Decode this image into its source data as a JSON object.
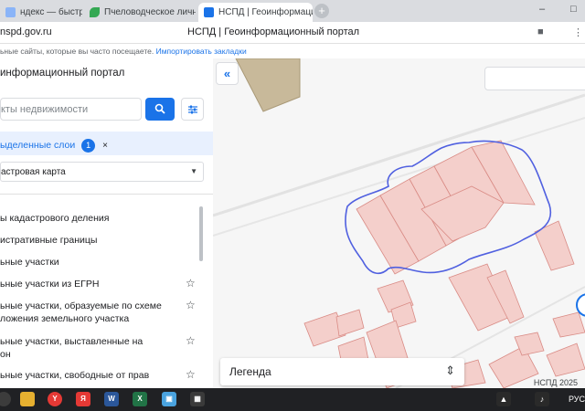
{
  "browser": {
    "tabs": [
      {
        "label": "ндекс — быстрый поиск",
        "icon": "yandex-tab-icon",
        "color": "#8ab4f8"
      },
      {
        "label": "Пчеловодческое личное",
        "icon": "plant-tab-icon",
        "color": "#34a853"
      },
      {
        "label": "НСПД | Геоинформацио",
        "icon": "nspd-tab-icon",
        "color": "#1a73e8"
      }
    ],
    "new_tab": "+",
    "minimize": "–",
    "maximize": "□",
    "url": "nspd.gov.ru",
    "page_title": "НСПД | Геоинформационный портал",
    "infobar_text": "ьные сайты, которые вы часто посещаете.",
    "infobar_link": "Импортировать закладки",
    "menu": "⋮",
    "bookmark": "■"
  },
  "sidebar": {
    "brand": "информационный портал",
    "search_placeholder": "кты недвижимости",
    "layers_label": "ыделенные слои",
    "layers_count": "1",
    "layers_clear": "×",
    "basemap": "астровая карта",
    "layers": [
      {
        "label": "ы кадастрового деления",
        "starred": false
      },
      {
        "label": "истративные границы",
        "starred": false
      },
      {
        "label": "ьные участки",
        "starred": false
      },
      {
        "label": "ьные участки из ЕГРН",
        "starred": true
      },
      {
        "label": "ьные участки, образуемые по схеме ложения земельного участка",
        "starred": true
      },
      {
        "label": "ьные участки, выставленные на он",
        "starred": true
      },
      {
        "label": "ьные участки, свободные от прав",
        "starred": true
      }
    ],
    "star_glyph": "☆"
  },
  "map": {
    "collapse": "«",
    "legend_title": "Легенда",
    "legend_toggle": "⇕",
    "copyright": "НСПД 2025",
    "parcel_fill": "#f4cfcb",
    "parcel_stroke": "#d98b85",
    "selection_stroke": "#5060e0"
  },
  "taskbar": {
    "apps": [
      {
        "name": "yandex-browser-icon",
        "color": "#e53935",
        "glyph": "Y"
      },
      {
        "name": "yandex-icon",
        "color": "#e53935",
        "glyph": "Я"
      },
      {
        "name": "word-icon",
        "color": "#2b579a",
        "glyph": "W"
      },
      {
        "name": "excel-icon",
        "color": "#217346",
        "glyph": "X"
      },
      {
        "name": "photos-icon",
        "color": "#4aa3df",
        "glyph": "▣"
      },
      {
        "name": "calculator-icon",
        "color": "#3a3a3a",
        "glyph": "▦"
      }
    ],
    "lang": "РУС"
  }
}
